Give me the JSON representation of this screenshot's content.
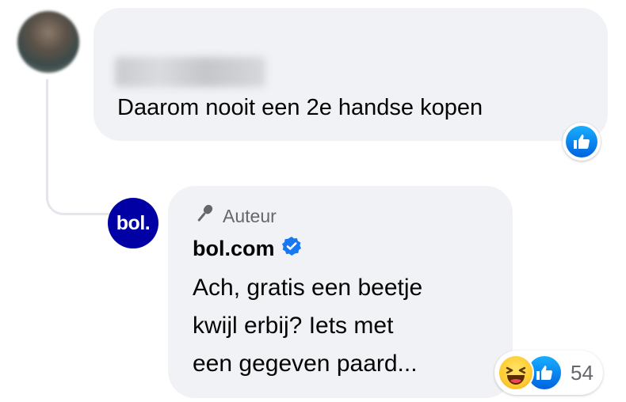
{
  "comment": {
    "text": "Daarom nooit een 2e handse kopen",
    "reaction": "like-icon"
  },
  "reply": {
    "avatar_text": "bol.",
    "author_badge": "Auteur",
    "author_badge_icon": "microphone-icon",
    "name": "bol.com",
    "verified_icon": "verified-badge-icon",
    "lines": [
      "Ach, gratis een beetje",
      "kwijl erbij? Iets met",
      "een gegeven paard..."
    ],
    "reactions": [
      "haha-icon",
      "like-icon"
    ],
    "reaction_count": "54"
  },
  "colors": {
    "bubble": "#f0f2f5",
    "like_blue": "#0866ff",
    "bol_blue": "#0000a4",
    "secondary_text": "#65676b"
  }
}
